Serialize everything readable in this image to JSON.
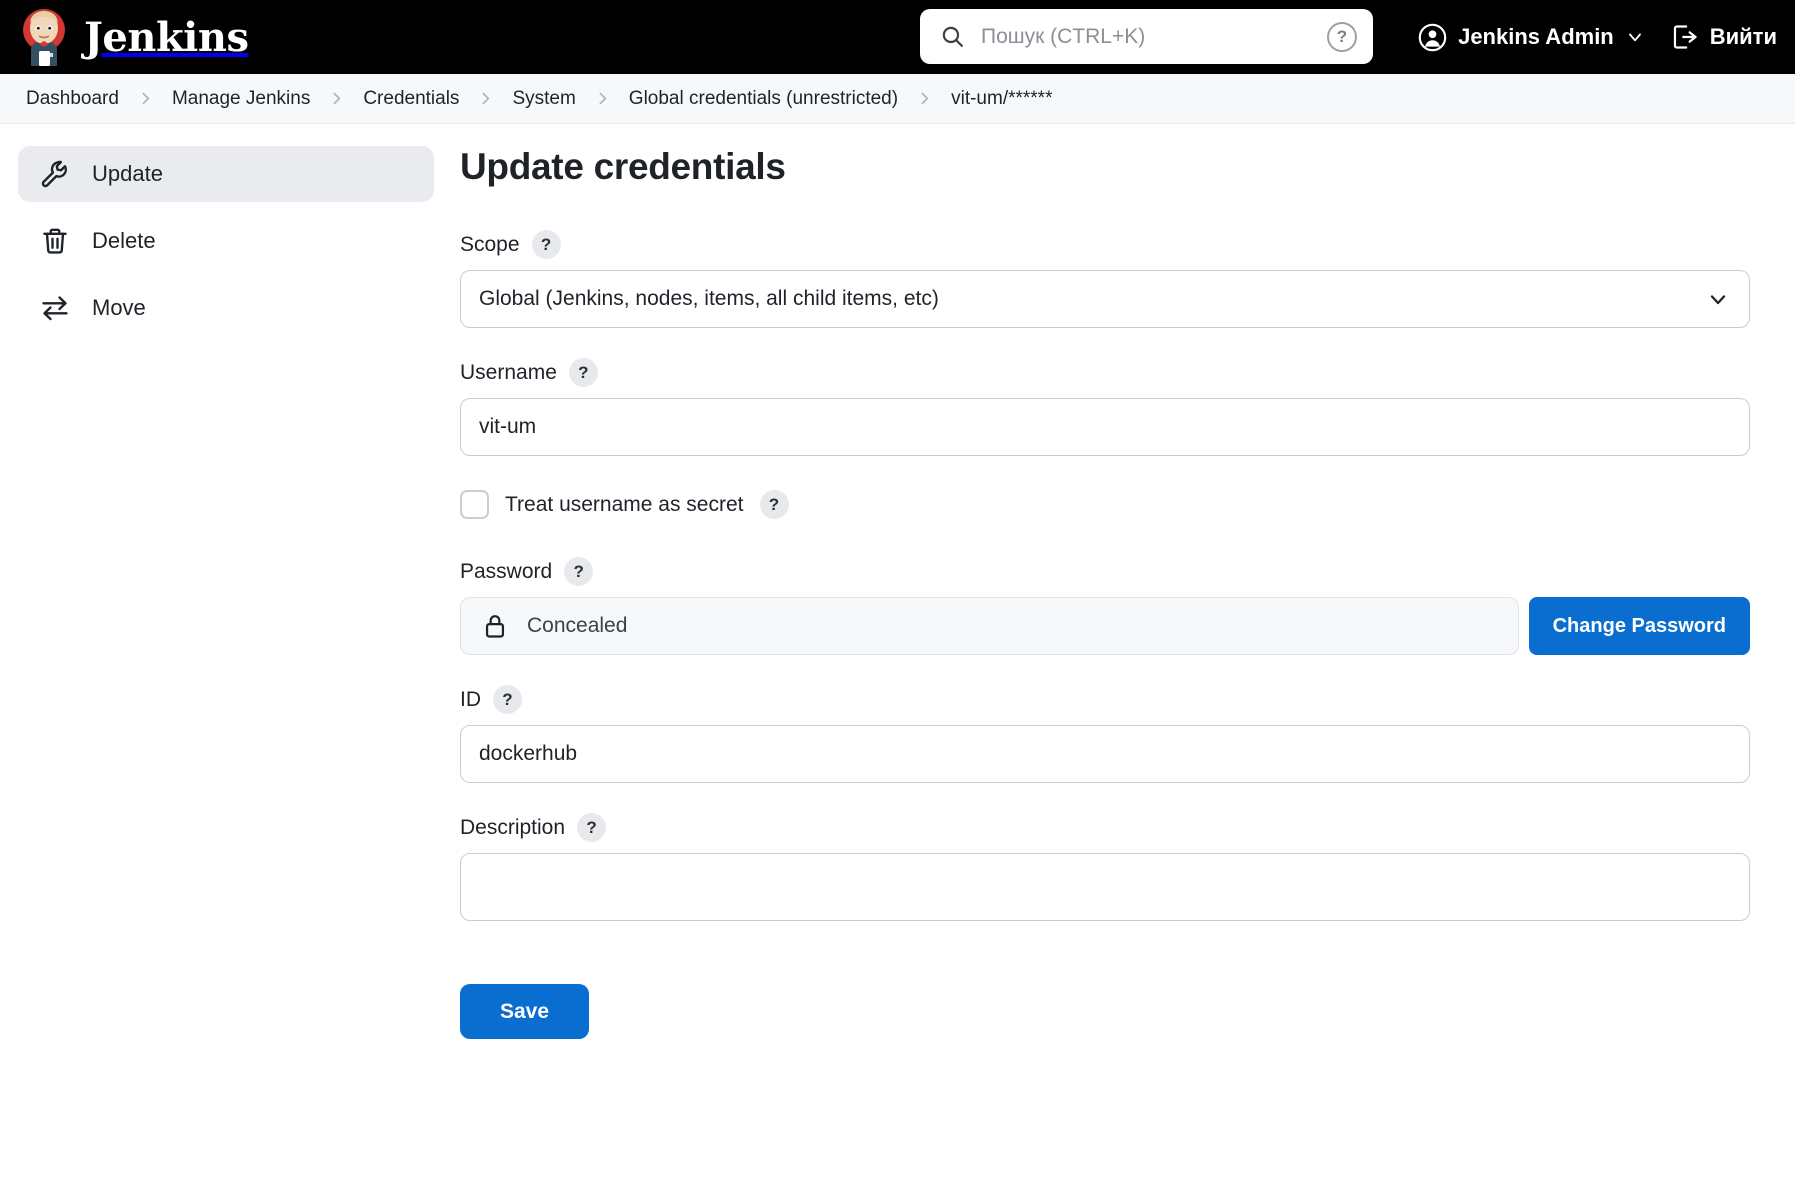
{
  "header": {
    "brand": "Jenkins",
    "search": {
      "placeholder": "Пошук (CTRL+K)",
      "value": "",
      "help_label": "?"
    },
    "user_name": "Jenkins Admin",
    "logout_label": "Вийти"
  },
  "breadcrumb": [
    "Dashboard",
    "Manage Jenkins",
    "Credentials",
    "System",
    "Global credentials (unrestricted)",
    "vit-um/******"
  ],
  "sidebar": {
    "items": [
      {
        "label": "Update",
        "icon": "wrench-icon",
        "active": true
      },
      {
        "label": "Delete",
        "icon": "trash-icon",
        "active": false
      },
      {
        "label": "Move",
        "icon": "move-arrows-icon",
        "active": false
      }
    ]
  },
  "main": {
    "title": "Update credentials",
    "help_label": "?",
    "scope": {
      "label": "Scope",
      "value": "Global (Jenkins, nodes, items, all child items, etc)"
    },
    "username": {
      "label": "Username",
      "value": "vit-um"
    },
    "treat_as_secret": {
      "label": "Treat username as secret",
      "checked": false
    },
    "password": {
      "label": "Password",
      "value": "Concealed",
      "change_button": "Change Password"
    },
    "id": {
      "label": "ID",
      "value": "dockerhub"
    },
    "description": {
      "label": "Description",
      "value": "",
      "placeholder": ""
    },
    "save_button": "Save"
  },
  "colors": {
    "accent": "#0a6ed1",
    "header_bg": "#000000",
    "breadcrumb_bg": "#f7f8fa",
    "active_item_bg": "#e9ebef",
    "border": "#c6ced8"
  }
}
